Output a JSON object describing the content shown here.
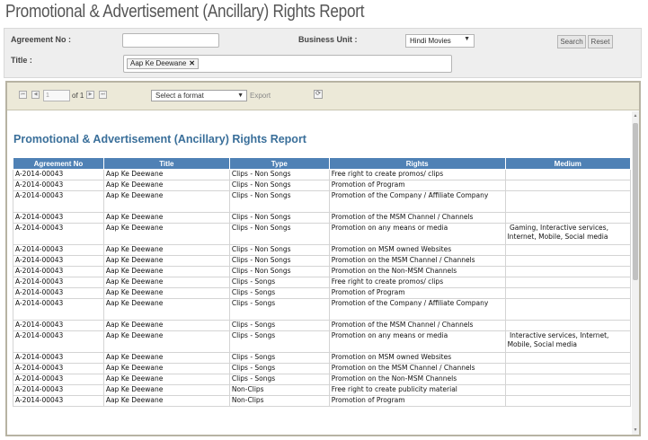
{
  "page": {
    "title": "Promotional & Advertisement (Ancillary) Rights Report"
  },
  "filters": {
    "agreement_label": "Agreement No :",
    "agreement_value": "",
    "business_unit_label": "Business Unit :",
    "business_unit_value": "Hindi Movies",
    "title_label": "Title :",
    "title_tag": "Aap Ke Deewane",
    "search_label": "Search",
    "reset_label": "Reset"
  },
  "toolbar": {
    "page_number": "1",
    "of_pages": "of 1",
    "format_placeholder": "Select a format",
    "export_label": "Export"
  },
  "report": {
    "title": "Promotional & Advertisement (Ancillary) Rights Report",
    "columns": [
      "Agreement No",
      "Title",
      "Type",
      "Rights",
      "Medium"
    ],
    "rows": [
      [
        "A-2014-00043",
        "Aap Ke Deewane",
        "Clips - Non Songs",
        "Free right to create promos/ clips",
        ""
      ],
      [
        "A-2014-00043",
        "Aap Ke Deewane",
        "Clips - Non Songs",
        "Promotion of Program",
        ""
      ],
      [
        "A-2014-00043",
        "Aap Ke Deewane",
        "Clips - Non Songs",
        "Promotion of the Company / Affiliate Company",
        ""
      ],
      [
        "A-2014-00043",
        "Aap Ke Deewane",
        "Clips - Non Songs",
        "Promotion of the MSM Channel / Channels",
        ""
      ],
      [
        "A-2014-00043",
        "Aap Ke Deewane",
        "Clips - Non Songs",
        "Promotion on any means or media",
        " Gaming, Interactive services,\nInternet, Mobile, Social media"
      ],
      [
        "A-2014-00043",
        "Aap Ke Deewane",
        "Clips - Non Songs",
        "Promotion on MSM owned Websites",
        ""
      ],
      [
        "A-2014-00043",
        "Aap Ke Deewane",
        "Clips - Non Songs",
        "Promotion on the MSM Channel / Channels",
        ""
      ],
      [
        "A-2014-00043",
        "Aap Ke Deewane",
        "Clips - Non Songs",
        "Promotion on the Non-MSM Channels",
        ""
      ],
      [
        "A-2014-00043",
        "Aap Ke Deewane",
        "Clips - Songs",
        "Free right to create promos/ clips",
        ""
      ],
      [
        "A-2014-00043",
        "Aap Ke Deewane",
        "Clips - Songs",
        "Promotion of Program",
        ""
      ],
      [
        "A-2014-00043",
        "Aap Ke Deewane",
        "Clips - Songs",
        "Promotion of the Company / Affiliate Company",
        ""
      ],
      [
        "A-2014-00043",
        "Aap Ke Deewane",
        "Clips - Songs",
        "Promotion of the MSM Channel / Channels",
        ""
      ],
      [
        "A-2014-00043",
        "Aap Ke Deewane",
        "Clips - Songs",
        "Promotion on any means or media",
        " Interactive services, Internet,\nMobile, Social media"
      ],
      [
        "A-2014-00043",
        "Aap Ke Deewane",
        "Clips - Songs",
        "Promotion on MSM owned Websites",
        ""
      ],
      [
        "A-2014-00043",
        "Aap Ke Deewane",
        "Clips - Songs",
        "Promotion on the MSM Channel / Channels",
        ""
      ],
      [
        "A-2014-00043",
        "Aap Ke Deewane",
        "Clips - Songs",
        "Promotion on the Non-MSM Channels",
        ""
      ],
      [
        "A-2014-00043",
        "Aap Ke Deewane",
        "Non-Clips",
        "Free right to create publicity material",
        ""
      ],
      [
        "A-2014-00043",
        "Aap Ke Deewane",
        "Non-Clips",
        "Promotion of Program",
        ""
      ]
    ]
  },
  "colors": {
    "header_bg": "#4f81b5",
    "title_color": "#3a6f9a",
    "toolbar_bg": "#ece9d8"
  }
}
